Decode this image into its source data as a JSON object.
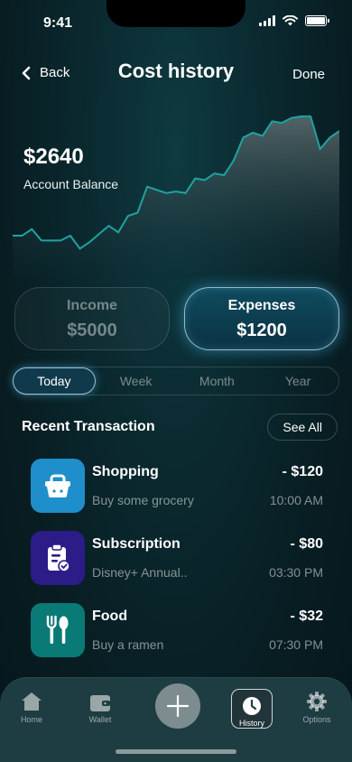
{
  "status": {
    "time": "9:41"
  },
  "nav": {
    "back_label": "Back",
    "title": "Cost history",
    "done_label": "Done"
  },
  "balance": {
    "amount": "$2640",
    "label": "Account Balance"
  },
  "chart_data": {
    "type": "area",
    "y": [
      26,
      26,
      30,
      23,
      23,
      23,
      26,
      18,
      22,
      27,
      32,
      28,
      38,
      40,
      56,
      54,
      52,
      53,
      52,
      61,
      60,
      64,
      63,
      72,
      86,
      89,
      87,
      96,
      95,
      98,
      99,
      99,
      79,
      86,
      90
    ],
    "ylim": [
      0,
      105
    ],
    "line_color": "#1fa3a3",
    "fill_top": "#5a6a6c",
    "fill_bottom": "#0b2a30"
  },
  "toggle": {
    "income": {
      "label": "Income",
      "amount": "$5000"
    },
    "expenses": {
      "label": "Expenses",
      "amount": "$1200"
    }
  },
  "period": [
    "Today",
    "Week",
    "Month",
    "Year"
  ],
  "recent": {
    "title": "Recent Transaction",
    "see_all": "See All"
  },
  "transactions": [
    {
      "name": "Shopping",
      "desc": "Buy some grocery",
      "amount": "- $120",
      "time": "10:00 AM",
      "icon": "basket-icon",
      "color": "#1e8fca"
    },
    {
      "name": "Subscription",
      "desc": "Disney+ Annual..",
      "amount": "- $80",
      "time": "03:30 PM",
      "icon": "clipboard-check-icon",
      "color": "#2b1c88"
    },
    {
      "name": "Food",
      "desc": "Buy a ramen",
      "amount": "- $32",
      "time": "07:30 PM",
      "icon": "cutlery-icon",
      "color": "#0a7a76"
    }
  ],
  "tabs": {
    "home": "Home",
    "wallet": "Wallet",
    "history": "History",
    "options": "Options"
  }
}
